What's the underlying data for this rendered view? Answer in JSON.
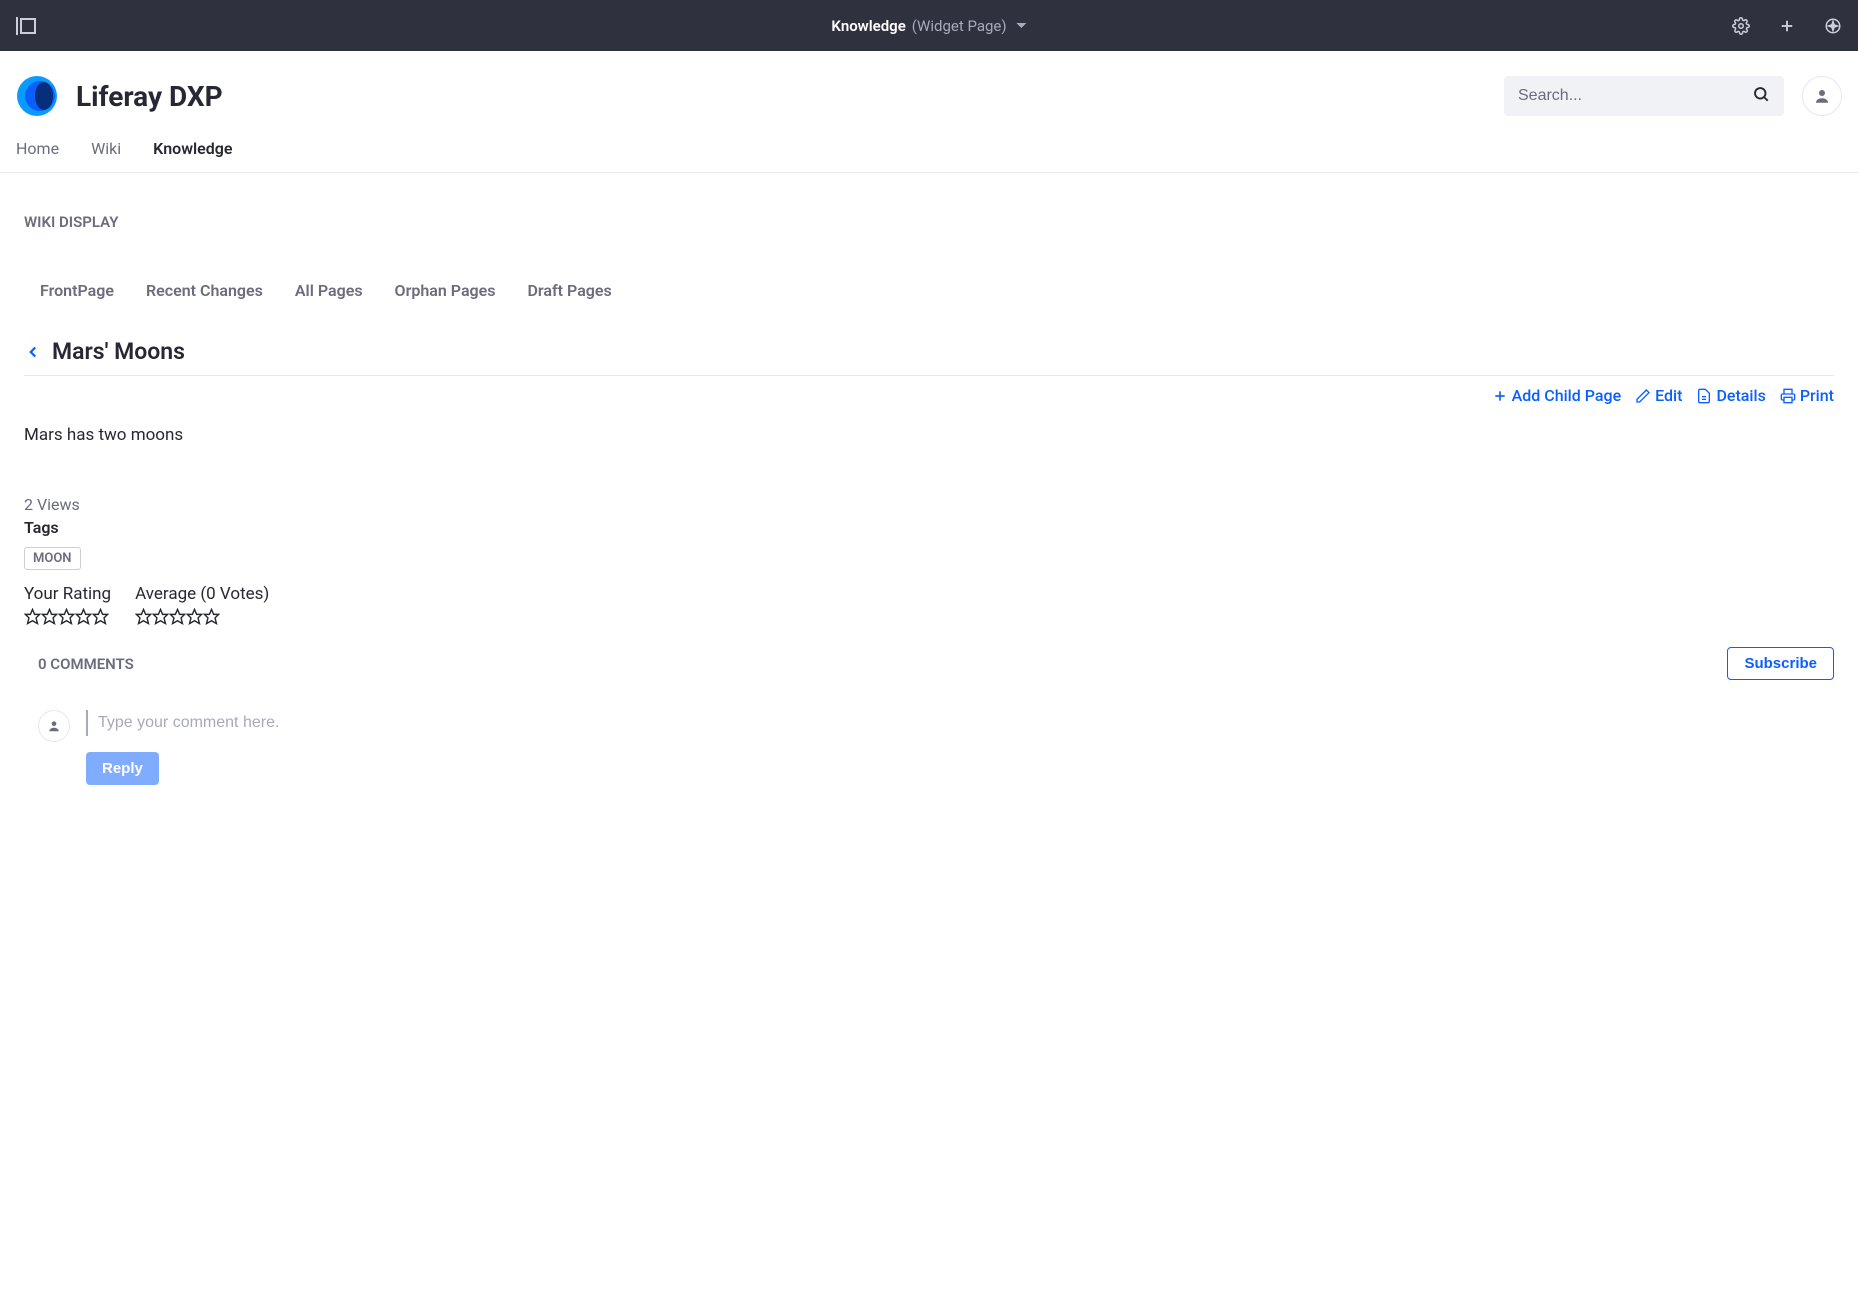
{
  "topbar": {
    "title_main": "Knowledge",
    "title_sub": "(Widget Page)"
  },
  "brand": {
    "name": "Liferay DXP"
  },
  "search": {
    "placeholder": "Search..."
  },
  "nav": {
    "items": [
      {
        "label": "Home"
      },
      {
        "label": "Wiki"
      },
      {
        "label": "Knowledge"
      }
    ],
    "active_index": 2
  },
  "portlet": {
    "title": "WIKI DISPLAY"
  },
  "wiki_tabs": [
    {
      "label": "FrontPage"
    },
    {
      "label": "Recent Changes"
    },
    {
      "label": "All Pages"
    },
    {
      "label": "Orphan Pages"
    },
    {
      "label": "Draft Pages"
    }
  ],
  "page": {
    "title": "Mars' Moons",
    "body": "Mars has two moons",
    "views": "2 Views"
  },
  "actions": {
    "add_child": "Add Child Page",
    "edit": "Edit",
    "details": "Details",
    "print": "Print"
  },
  "tags": {
    "label": "Tags",
    "items": [
      "MOON"
    ]
  },
  "ratings": {
    "your_label": "Your Rating",
    "avg_label": "Average (0 Votes)"
  },
  "comments": {
    "count_label": "0 COMMENTS",
    "subscribe": "Subscribe",
    "placeholder": "Type your comment here.",
    "reply": "Reply"
  }
}
